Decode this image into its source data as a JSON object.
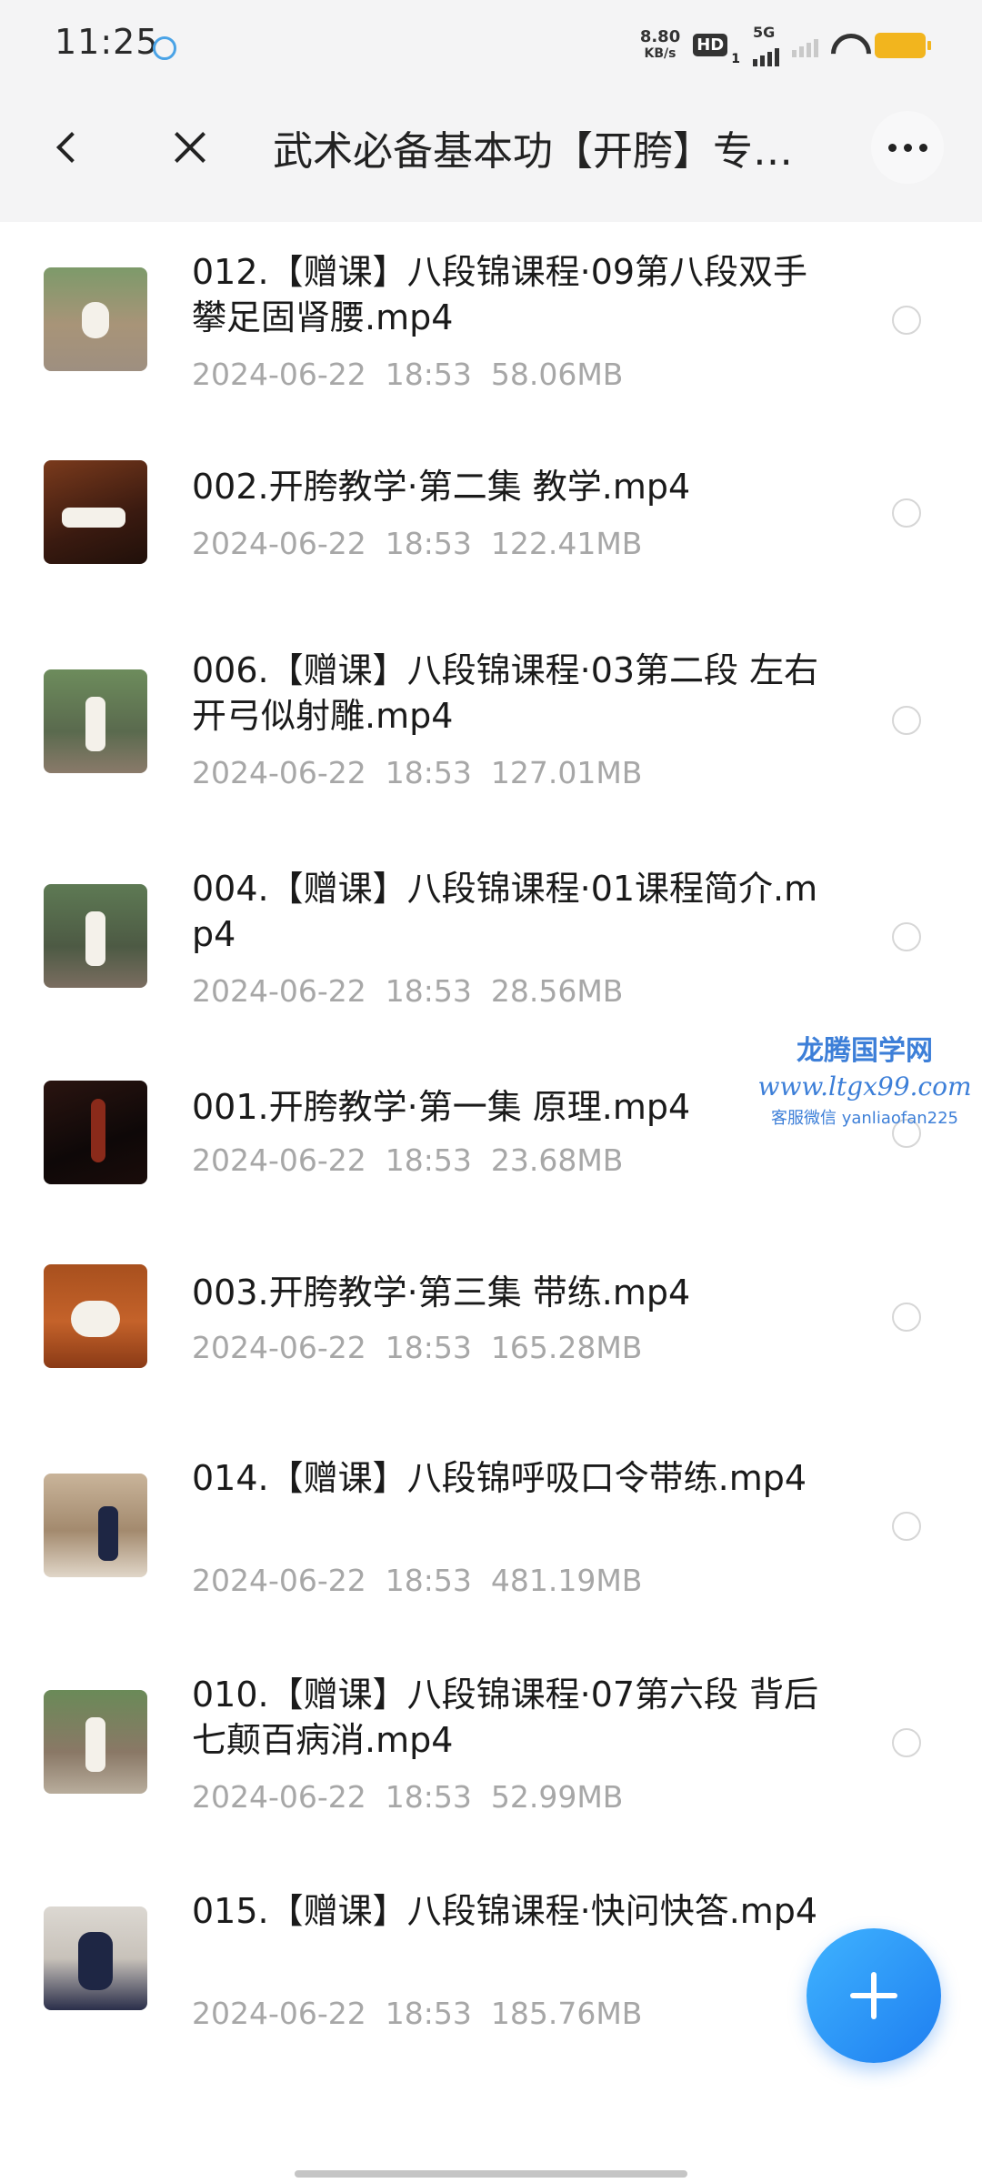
{
  "status_bar": {
    "time": "11:25",
    "net_speed_value": "8.80",
    "net_speed_unit": "KB/s",
    "hd_label": "HD",
    "hd_sub": "1",
    "network_label": "5G",
    "battery_color": "#f2b51e"
  },
  "header": {
    "title": "武术必备基本功【开胯】专…",
    "back_icon": "chevron-left",
    "close_icon": "close",
    "more_icon": "ellipsis"
  },
  "files": [
    {
      "name": "012.【赠课】八段锦课程·09第八段双手攀足固肾腰.mp4",
      "date": "2024-06-22",
      "time": "18:53",
      "size": "58.06MB"
    },
    {
      "name": "002.开胯教学·第二集 教学.mp4",
      "date": "2024-06-22",
      "time": "18:53",
      "size": "122.41MB"
    },
    {
      "name": "006.【赠课】八段锦课程·03第二段 左右开弓似射雕.mp4",
      "date": "2024-06-22",
      "time": "18:53",
      "size": "127.01MB"
    },
    {
      "name": "004.【赠课】八段锦课程·01课程简介.mp4",
      "date": "2024-06-22",
      "time": "18:53",
      "size": "28.56MB"
    },
    {
      "name": "001.开胯教学·第一集 原理.mp4",
      "date": "2024-06-22",
      "time": "18:53",
      "size": "23.68MB"
    },
    {
      "name": "003.开胯教学·第三集 带练.mp4",
      "date": "2024-06-22",
      "time": "18:53",
      "size": "165.28MB"
    },
    {
      "name": "014.【赠课】八段锦呼吸口令带练.mp4",
      "date": "2024-06-22",
      "time": "18:53",
      "size": "481.19MB"
    },
    {
      "name": "010.【赠课】八段锦课程·07第六段 背后七颠百病消.mp4",
      "date": "2024-06-22",
      "time": "18:53",
      "size": "52.99MB"
    },
    {
      "name": "015.【赠课】八段锦课程·快问快答.mp4",
      "date": "2024-06-22",
      "time": "18:53",
      "size": "185.76MB"
    }
  ],
  "watermark": {
    "title": "龙腾国学网",
    "url": "www.ltgx99.com",
    "contact": "客服微信 yanliaofan225"
  },
  "fab": {
    "icon": "plus",
    "color": "#1e7ef0"
  }
}
